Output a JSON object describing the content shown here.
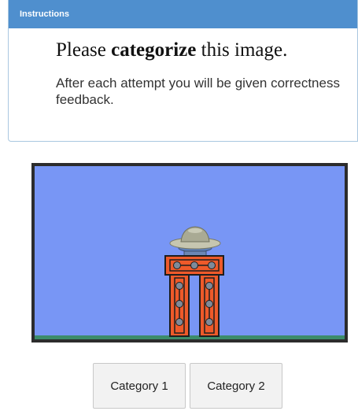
{
  "instructions": {
    "header": "Instructions",
    "headline_before": "Please ",
    "headline_bold": "categorize",
    "headline_after": " this image.",
    "feedback_text": "After each attempt you will be given correctness feedback."
  },
  "stage": {
    "background_color": "#7896f5",
    "objects": [
      "ufo-icon",
      "tower-structure"
    ]
  },
  "buttons": {
    "category_1": "Category 1",
    "category_2": "Category 2"
  }
}
